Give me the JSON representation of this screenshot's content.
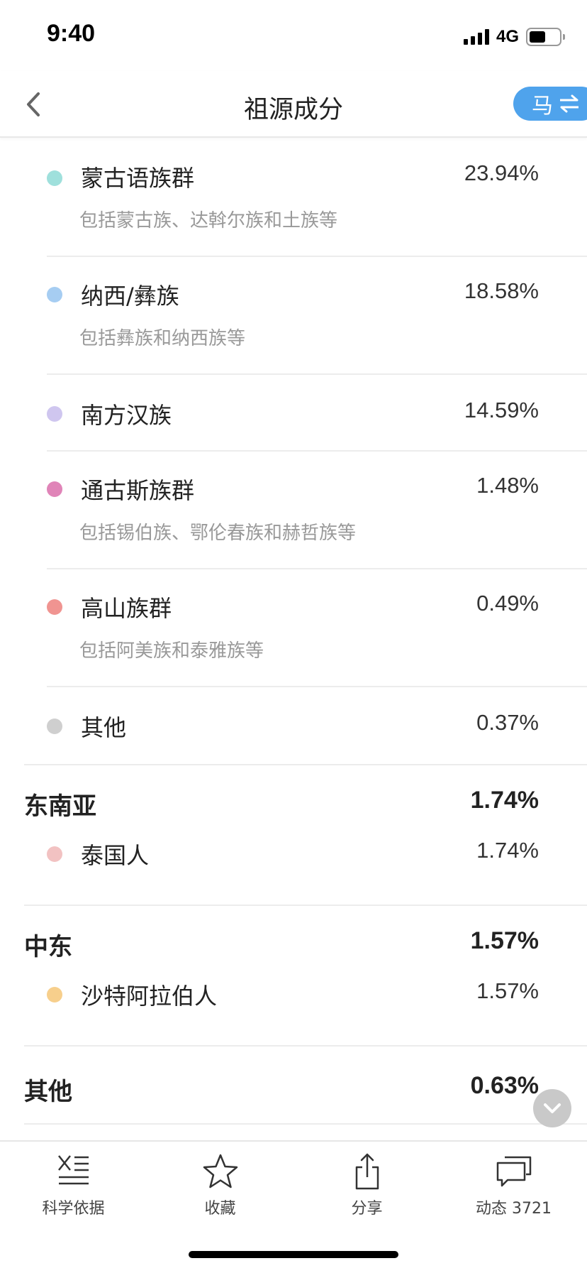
{
  "status_bar": {
    "time": "9:40",
    "network": "4G"
  },
  "nav": {
    "title": "祖源成分",
    "switch_label": "马",
    "switch_icon": "swap-arrows-icon"
  },
  "items": [
    {
      "name": "蒙古语族群",
      "pct": "23.94%",
      "desc": "包括蒙古族、达斡尔族和土族等",
      "color": "#9fe0dc"
    },
    {
      "name": "纳西/彝族",
      "pct": "18.58%",
      "desc": "包括彝族和纳西族等",
      "color": "#a6cdf2"
    },
    {
      "name": "南方汉族",
      "pct": "14.59%",
      "desc": "",
      "color": "#cfc6ef"
    },
    {
      "name": "通古斯族群",
      "pct": "1.48%",
      "desc": "包括锡伯族、鄂伦春族和赫哲族等",
      "color": "#e084b8"
    },
    {
      "name": "高山族群",
      "pct": "0.49%",
      "desc": "包括阿美族和泰雅族等",
      "color": "#f09491"
    },
    {
      "name": "其他",
      "pct": "0.37%",
      "desc": "",
      "color": "#cfcfcf"
    }
  ],
  "regions": [
    {
      "name": "东南亚",
      "pct": "1.74%",
      "children": [
        {
          "name": "泰国人",
          "pct": "1.74%",
          "color": "#f2c2c2"
        }
      ]
    },
    {
      "name": "中东",
      "pct": "1.57%",
      "children": [
        {
          "name": "沙特阿拉伯人",
          "pct": "1.57%",
          "color": "#f7cf8c"
        }
      ]
    },
    {
      "name": "其他",
      "pct": "0.63%",
      "children": []
    }
  ],
  "tabs": [
    {
      "label": "科学依据",
      "icon": "dna-icon"
    },
    {
      "label": "收藏",
      "icon": "star-icon"
    },
    {
      "label": "分享",
      "icon": "share-icon"
    },
    {
      "label": "动态 3721",
      "icon": "chat-bubbles-icon"
    }
  ]
}
